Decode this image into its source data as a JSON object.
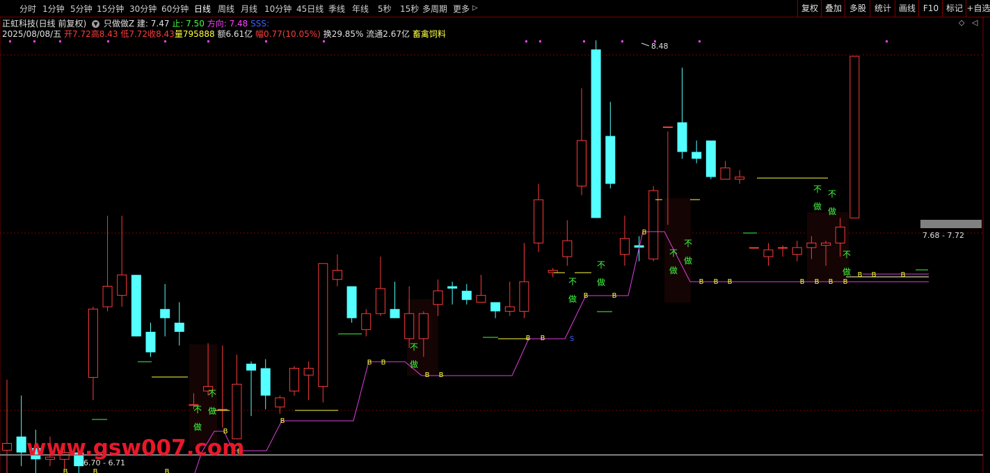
{
  "toolbar": {
    "periods": [
      "分时",
      "1分钟",
      "5分钟",
      "15分钟",
      "30分钟",
      "60分钟",
      "日线",
      "周线",
      "月线",
      "10分钟",
      "45日线",
      "季线",
      "年线",
      "5秒",
      "15秒",
      "多周期",
      "更多"
    ],
    "active_period": "日线",
    "more_arrow": "▷",
    "right_buttons": [
      "复权",
      "叠加",
      "多股",
      "统计",
      "画线",
      "F10",
      "标记",
      "+自选"
    ]
  },
  "header": {
    "stock": "正虹科技(日线 前复权)",
    "indicator_name": "只做做Z",
    "jian_label": "建: 7.47",
    "zhi_label": "止: 7.50",
    "fangxiang_label": "方向: 7.48",
    "sss_label": "SSS:",
    "date": "2025/08/08/五",
    "open": "开7.72",
    "high": "高8.43",
    "low": "低7.72",
    "close": "收8.43",
    "volume": "量795888",
    "amount": "额6.61亿",
    "range": "幅0.77(10.05%)",
    "turnover": "换29.85%",
    "float_cap": "流通2.67亿",
    "concept": "畜禽饲料"
  },
  "labels": {
    "high_mark": "8.48",
    "range_right": "7.68 - 7.72",
    "range_left": "6.70 - 6.71",
    "buy_char": "B",
    "no_do_1": "不",
    "no_do_2": "做"
  },
  "watermark": "www.gsw007.com",
  "colors": {
    "up": "#ff3b3b",
    "down": "#54ffff",
    "line": "#e040e0",
    "buy": "#ffff40",
    "nodo": "#40ff40",
    "grid": "#800000"
  },
  "candles": [
    {
      "o": 6.7,
      "c": 6.73,
      "h": 7.01,
      "l": 6.6
    },
    {
      "o": 6.76,
      "c": 6.69,
      "h": 6.94,
      "l": 6.63
    },
    {
      "o": 6.71,
      "c": 6.66,
      "h": 6.79,
      "l": 6.6
    },
    {
      "o": 6.66,
      "c": 6.67,
      "h": 6.76,
      "l": 6.63
    },
    {
      "o": 6.66,
      "c": 6.69,
      "h": 6.72,
      "l": 6.62
    },
    {
      "o": 6.69,
      "c": 6.63,
      "h": 6.7,
      "l": 6.6
    },
    {
      "o": 7.02,
      "c": 7.32,
      "h": 7.33,
      "l": 6.92
    },
    {
      "o": 7.33,
      "c": 7.42,
      "h": 7.73,
      "l": 7.31
    },
    {
      "o": 7.38,
      "c": 7.47,
      "h": 7.73,
      "l": 7.33
    },
    {
      "o": 7.47,
      "c": 7.2,
      "h": 7.47,
      "l": 7.2
    },
    {
      "o": 7.22,
      "c": 7.13,
      "h": 7.26,
      "l": 7.11
    },
    {
      "o": 7.32,
      "c": 7.28,
      "h": 7.43,
      "l": 7.2
    },
    {
      "o": 7.26,
      "c": 7.22,
      "h": 7.35,
      "l": 7.16
    },
    {
      "o": 6.9,
      "c": 6.9,
      "h": 6.95,
      "l": 6.88
    },
    {
      "o": 6.96,
      "c": 6.98,
      "h": 7.17,
      "l": 6.94
    },
    {
      "o": 6.88,
      "c": 6.88,
      "h": 7.16,
      "l": 6.8
    },
    {
      "o": 6.75,
      "c": 6.99,
      "h": 7.12,
      "l": 6.75
    },
    {
      "o": 7.08,
      "c": 7.05,
      "h": 7.09,
      "l": 6.85
    },
    {
      "o": 7.06,
      "c": 6.94,
      "h": 7.1,
      "l": 6.88
    },
    {
      "o": 6.89,
      "c": 6.93,
      "h": 6.94,
      "l": 6.86
    },
    {
      "o": 6.96,
      "c": 7.06,
      "h": 7.07,
      "l": 6.94
    },
    {
      "o": 7.03,
      "c": 7.06,
      "h": 7.09,
      "l": 6.92
    },
    {
      "o": 6.98,
      "c": 7.52,
      "h": 7.52,
      "l": 6.91
    },
    {
      "o": 7.45,
      "c": 7.49,
      "h": 7.56,
      "l": 7.42
    },
    {
      "o": 7.42,
      "c": 7.28,
      "h": 7.41,
      "l": 7.26
    },
    {
      "o": 7.23,
      "c": 7.3,
      "h": 7.32,
      "l": 7.2
    },
    {
      "o": 7.3,
      "c": 7.41,
      "h": 7.55,
      "l": 7.29
    },
    {
      "o": 7.32,
      "c": 7.28,
      "h": 7.44,
      "l": 7.28
    },
    {
      "o": 7.19,
      "c": 7.3,
      "h": 7.42,
      "l": 7.15
    },
    {
      "o": 7.19,
      "c": 7.3,
      "h": 7.31,
      "l": 7.11
    },
    {
      "o": 7.34,
      "c": 7.4,
      "h": 7.45,
      "l": 7.29
    },
    {
      "o": 7.42,
      "c": 7.41,
      "h": 7.44,
      "l": 7.34
    },
    {
      "o": 7.4,
      "c": 7.36,
      "h": 7.43,
      "l": 7.34
    },
    {
      "o": 7.35,
      "c": 7.38,
      "h": 7.47,
      "l": 7.35
    },
    {
      "o": 7.35,
      "c": 7.31,
      "h": 7.35,
      "l": 7.28
    },
    {
      "o": 7.31,
      "c": 7.33,
      "h": 7.44,
      "l": 7.29
    },
    {
      "o": 7.31,
      "c": 7.44,
      "h": 7.61,
      "l": 7.28
    },
    {
      "o": 7.61,
      "c": 7.8,
      "h": 7.87,
      "l": 7.57
    },
    {
      "o": 7.48,
      "c": 7.49,
      "h": 7.5,
      "l": 7.46
    },
    {
      "o": 7.55,
      "c": 7.62,
      "h": 7.71,
      "l": 7.51
    },
    {
      "o": 7.86,
      "c": 8.06,
      "h": 8.29,
      "l": 7.82
    },
    {
      "o": 8.46,
      "c": 7.72,
      "h": 8.5,
      "l": 7.72
    },
    {
      "o": 8.08,
      "c": 7.87,
      "h": 8.23,
      "l": 7.85
    },
    {
      "o": 7.56,
      "c": 7.63,
      "h": 7.73,
      "l": 7.51
    },
    {
      "o": 7.6,
      "c": 7.59,
      "h": 7.64,
      "l": 7.53
    },
    {
      "o": 7.54,
      "c": 7.84,
      "h": 7.86,
      "l": 7.53
    },
    {
      "o": 8.12,
      "c": 8.12,
      "h": 8.1,
      "l": 7.69
    },
    {
      "o": 8.14,
      "c": 8.01,
      "h": 8.38,
      "l": 7.98
    },
    {
      "o": 8.01,
      "c": 7.98,
      "h": 8.06,
      "l": 7.96
    },
    {
      "o": 8.06,
      "c": 7.9,
      "h": 8.0,
      "l": 7.89
    },
    {
      "o": 7.89,
      "c": 7.94,
      "h": 7.97,
      "l": 7.92
    },
    {
      "o": 7.89,
      "c": 7.9,
      "h": 7.93,
      "l": 7.87
    },
    {
      "o": 7.59,
      "c": 7.59,
      "h": 7.59,
      "l": 7.59
    },
    {
      "o": 7.55,
      "c": 7.58,
      "h": 7.61,
      "l": 7.51
    },
    {
      "o": 7.59,
      "c": 7.59,
      "h": 7.6,
      "l": 7.55
    },
    {
      "o": 7.56,
      "c": 7.59,
      "h": 7.62,
      "l": 7.53
    },
    {
      "o": 7.59,
      "c": 7.61,
      "h": 7.64,
      "l": 7.54
    },
    {
      "o": 7.6,
      "c": 7.61,
      "h": 7.62,
      "l": 7.51
    },
    {
      "o": 7.61,
      "c": 7.68,
      "h": 7.72,
      "l": 7.55
    },
    {
      "o": 7.72,
      "c": 8.43,
      "h": 8.43,
      "l": 7.72
    }
  ]
}
